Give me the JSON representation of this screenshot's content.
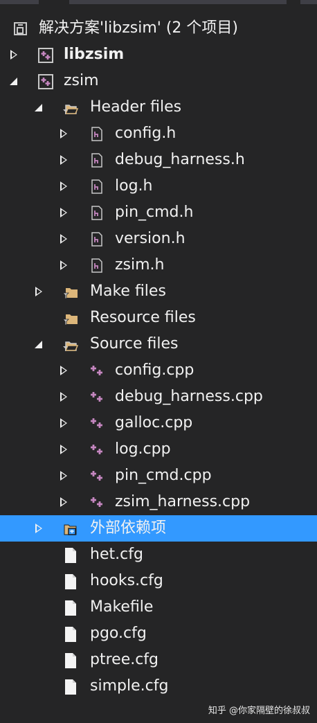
{
  "solution": {
    "title": "解决方案'libzsim' (2 个项目)"
  },
  "tree": [
    {
      "label": "libzsim",
      "level": 1,
      "state": "collapsed",
      "icon": "cpp-project-icon",
      "bold": true
    },
    {
      "label": "zsim",
      "level": 1,
      "state": "expanded",
      "icon": "cpp-project-icon"
    },
    {
      "label": "Header files",
      "level": 2,
      "state": "expanded",
      "icon": "filter-folder-open-icon"
    },
    {
      "label": "config.h",
      "level": 3,
      "state": "collapsed",
      "icon": "header-file-icon"
    },
    {
      "label": "debug_harness.h",
      "level": 3,
      "state": "collapsed",
      "icon": "header-file-icon"
    },
    {
      "label": "log.h",
      "level": 3,
      "state": "collapsed",
      "icon": "header-file-icon"
    },
    {
      "label": "pin_cmd.h",
      "level": 3,
      "state": "collapsed",
      "icon": "header-file-icon"
    },
    {
      "label": "version.h",
      "level": 3,
      "state": "collapsed",
      "icon": "header-file-icon"
    },
    {
      "label": "zsim.h",
      "level": 3,
      "state": "collapsed",
      "icon": "header-file-icon"
    },
    {
      "label": "Make files",
      "level": 2,
      "state": "collapsed",
      "icon": "filter-folder-icon"
    },
    {
      "label": "Resource files",
      "level": 2,
      "state": "none",
      "icon": "filter-folder-icon"
    },
    {
      "label": "Source files",
      "level": 2,
      "state": "expanded",
      "icon": "filter-folder-open-icon"
    },
    {
      "label": "config.cpp",
      "level": 3,
      "state": "collapsed",
      "icon": "cpp-file-icon"
    },
    {
      "label": "debug_harness.cpp",
      "level": 3,
      "state": "collapsed",
      "icon": "cpp-file-icon"
    },
    {
      "label": "galloc.cpp",
      "level": 3,
      "state": "collapsed",
      "icon": "cpp-file-icon"
    },
    {
      "label": "log.cpp",
      "level": 3,
      "state": "collapsed",
      "icon": "cpp-file-icon"
    },
    {
      "label": "pin_cmd.cpp",
      "level": 3,
      "state": "collapsed",
      "icon": "cpp-file-icon"
    },
    {
      "label": "zsim_harness.cpp",
      "level": 3,
      "state": "collapsed",
      "icon": "cpp-file-icon"
    },
    {
      "label": "外部依赖项",
      "level": 2,
      "state": "collapsed",
      "icon": "external-dependencies-icon",
      "selected": true
    },
    {
      "label": "het.cfg",
      "level": 2,
      "state": "none",
      "icon": "text-file-icon"
    },
    {
      "label": "hooks.cfg",
      "level": 2,
      "state": "none",
      "icon": "text-file-icon"
    },
    {
      "label": "Makefile",
      "level": 2,
      "state": "none",
      "icon": "text-file-icon"
    },
    {
      "label": "pgo.cfg",
      "level": 2,
      "state": "none",
      "icon": "text-file-icon"
    },
    {
      "label": "ptree.cfg",
      "level": 2,
      "state": "none",
      "icon": "text-file-icon"
    },
    {
      "label": "simple.cfg",
      "level": 2,
      "state": "none",
      "icon": "text-file-icon"
    }
  ],
  "watermark": "知乎 @你家隔壁的徐叔叔",
  "colors": {
    "background": "#252526",
    "selection": "#3399ff",
    "text": "#f1f1f1",
    "folder": "#dcb67a",
    "cpp": "#c586c0"
  }
}
